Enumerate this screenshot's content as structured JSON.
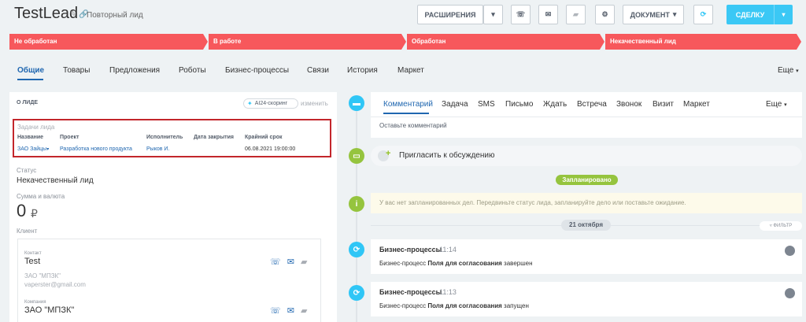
{
  "header": {
    "title": "TestLead",
    "title_icons": "✎ 🔗",
    "subtitle": "Повторный лид",
    "extensions_label": "РАСШИРЕНИЯ",
    "document_label": "ДОКУМЕНТ",
    "deal_label": "СДЕЛКУ"
  },
  "stages": [
    "Не обработан",
    "В работе",
    "Обработан",
    "Некачественный лид"
  ],
  "tabs": {
    "general": "Общие",
    "products": "Товары",
    "offers": "Предложения",
    "robots": "Роботы",
    "bp": "Бизнес-процессы",
    "links": "Связи",
    "history": "История",
    "market": "Маркет",
    "more": "Еще"
  },
  "about": {
    "title": "О ЛИДЕ",
    "ai_badge": "AI24-скоринг",
    "change": "изменить",
    "tasks_caption": "Задачи лида",
    "tasks_headers": {
      "name": "Название",
      "project": "Проект",
      "assignee": "Исполнитель",
      "closed": "Дата закрытия",
      "deadline": "Крайний срок"
    },
    "task_row": {
      "name": "ЗАО Зайцы",
      "project": "Разработка нового продукта",
      "assignee": "Рыков И.",
      "closed": "",
      "deadline": "06.08.2021 19:00:00"
    },
    "status_label": "Статус",
    "status_value": "Некачественный лид",
    "sum_label": "Сумма и валюта",
    "sum_value": "0",
    "currency": "₽",
    "client_label": "Клиент"
  },
  "client": {
    "contact_label": "Контакт",
    "contact_name": "Test",
    "contact_company": "ЗАО \"МПЗК\"",
    "contact_email": "vaperster@gmail.com",
    "company_label": "Компания",
    "company_name": "ЗАО \"МПЗК\""
  },
  "activity": {
    "tabs": [
      "Комментарий",
      "Задача",
      "SMS",
      "Письмо",
      "Ждать",
      "Встреча",
      "Звонок",
      "Визит",
      "Маркет",
      "Еще"
    ],
    "comment_hint": "Оставьте комментарий",
    "invite": "Пригласить к обсуждению",
    "planned": "Запланировано",
    "warning": "У вас нет запланированных дел. Передвиньте статус лида, запланируйте дело или поставьте ожидание.",
    "date": "21 октября",
    "filter": "ФИЛЬТР"
  },
  "events": [
    {
      "title": "Бизнес-процессы",
      "time": "11:14",
      "prefix": "Бизнес-процесс",
      "name": "Поля для согласования",
      "suffix": "завершен"
    },
    {
      "title": "Бизнес-процессы",
      "time": "11:13",
      "prefix": "Бизнес-процесс",
      "name": "Поля для согласования",
      "suffix": "запущен"
    }
  ],
  "colors": {
    "stage": "#f7585c",
    "accent": "#2067b0",
    "deal_button": "#3bc8f5",
    "planned": "#95c43e",
    "highlight_border": "#c3262b"
  }
}
